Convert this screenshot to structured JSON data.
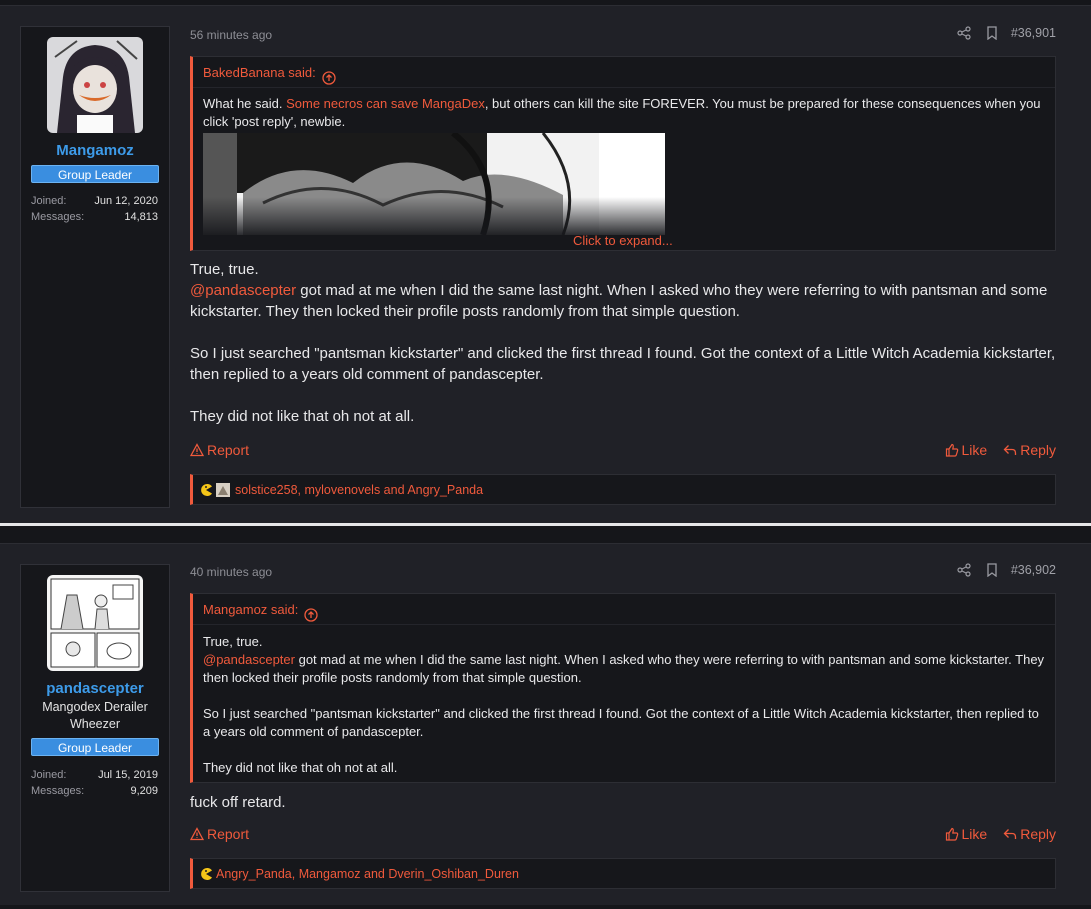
{
  "posts": [
    {
      "user": {
        "name": "Mangamoz",
        "title": "",
        "badge": "Group Leader",
        "joined_label": "Joined:",
        "joined": "Jun 12, 2020",
        "messages_label": "Messages:",
        "messages": "14,813"
      },
      "time": "56 minutes ago",
      "number": "#36,901",
      "quote": {
        "author": "BakedBanana said:",
        "text_pre": "What he said. ",
        "text_link": "Some necros can save MangaDex",
        "text_post": ", but others can kill the site FOREVER. You must be prepared for these consequences when you click 'post reply', newbie.",
        "expand": "Click to expand..."
      },
      "body": {
        "line1": "True, true.",
        "mention": "@pandascepter",
        "line2": " got mad at me when I did the same last night. When I asked who they were referring to with pantsman and some kickstarter. They then locked their profile posts randomly from that simple question.",
        "para2": "So I just searched \"pantsman kickstarter\" and clicked the first thread I found. Got the context of a Little Witch Academia kickstarter, then replied to a years old comment of pandascepter.",
        "para3": "They did not like that oh not at all."
      },
      "report": "Report",
      "like": "Like",
      "reply": "Reply",
      "reactions": "solstice258, mylovenovels and Angry_Panda"
    },
    {
      "user": {
        "name": "pandascepter",
        "title": "Mangodex Derailer Wheezer",
        "badge": "Group Leader",
        "joined_label": "Joined:",
        "joined": "Jul 15, 2019",
        "messages_label": "Messages:",
        "messages": "9,209"
      },
      "time": "40 minutes ago",
      "number": "#36,902",
      "quote": {
        "author": "Mangamoz said:",
        "line1": "True, true.",
        "mention": "@pandascepter",
        "line2": " got mad at me when I did the same last night. When I asked who they were referring to with pantsman and some kickstarter. They then locked their profile posts randomly from that simple question.",
        "para2": "So I just searched \"pantsman kickstarter\" and clicked the first thread I found. Got the context of a Little Witch Academia kickstarter, then replied to a years old comment of pandascepter.",
        "para3": "They did not like that oh not at all."
      },
      "body": "fuck off retard.",
      "report": "Report",
      "like": "Like",
      "reply": "Reply",
      "reactions": "Angry_Panda, Mangamoz and Dverin_Oshiban_Duren"
    }
  ],
  "colors": {
    "accent": "#f05a3c",
    "username": "#3d9be9",
    "badge": "#3a8ee0",
    "panel": "#16171b",
    "post_bg": "#202127"
  },
  "icons": [
    "share-icon",
    "bookmark-icon",
    "arrow-up-circle-icon",
    "warning-icon",
    "thumbs-up-icon",
    "reply-icon",
    "pacman-reaction-icon",
    "sticker-reaction-icon"
  ]
}
